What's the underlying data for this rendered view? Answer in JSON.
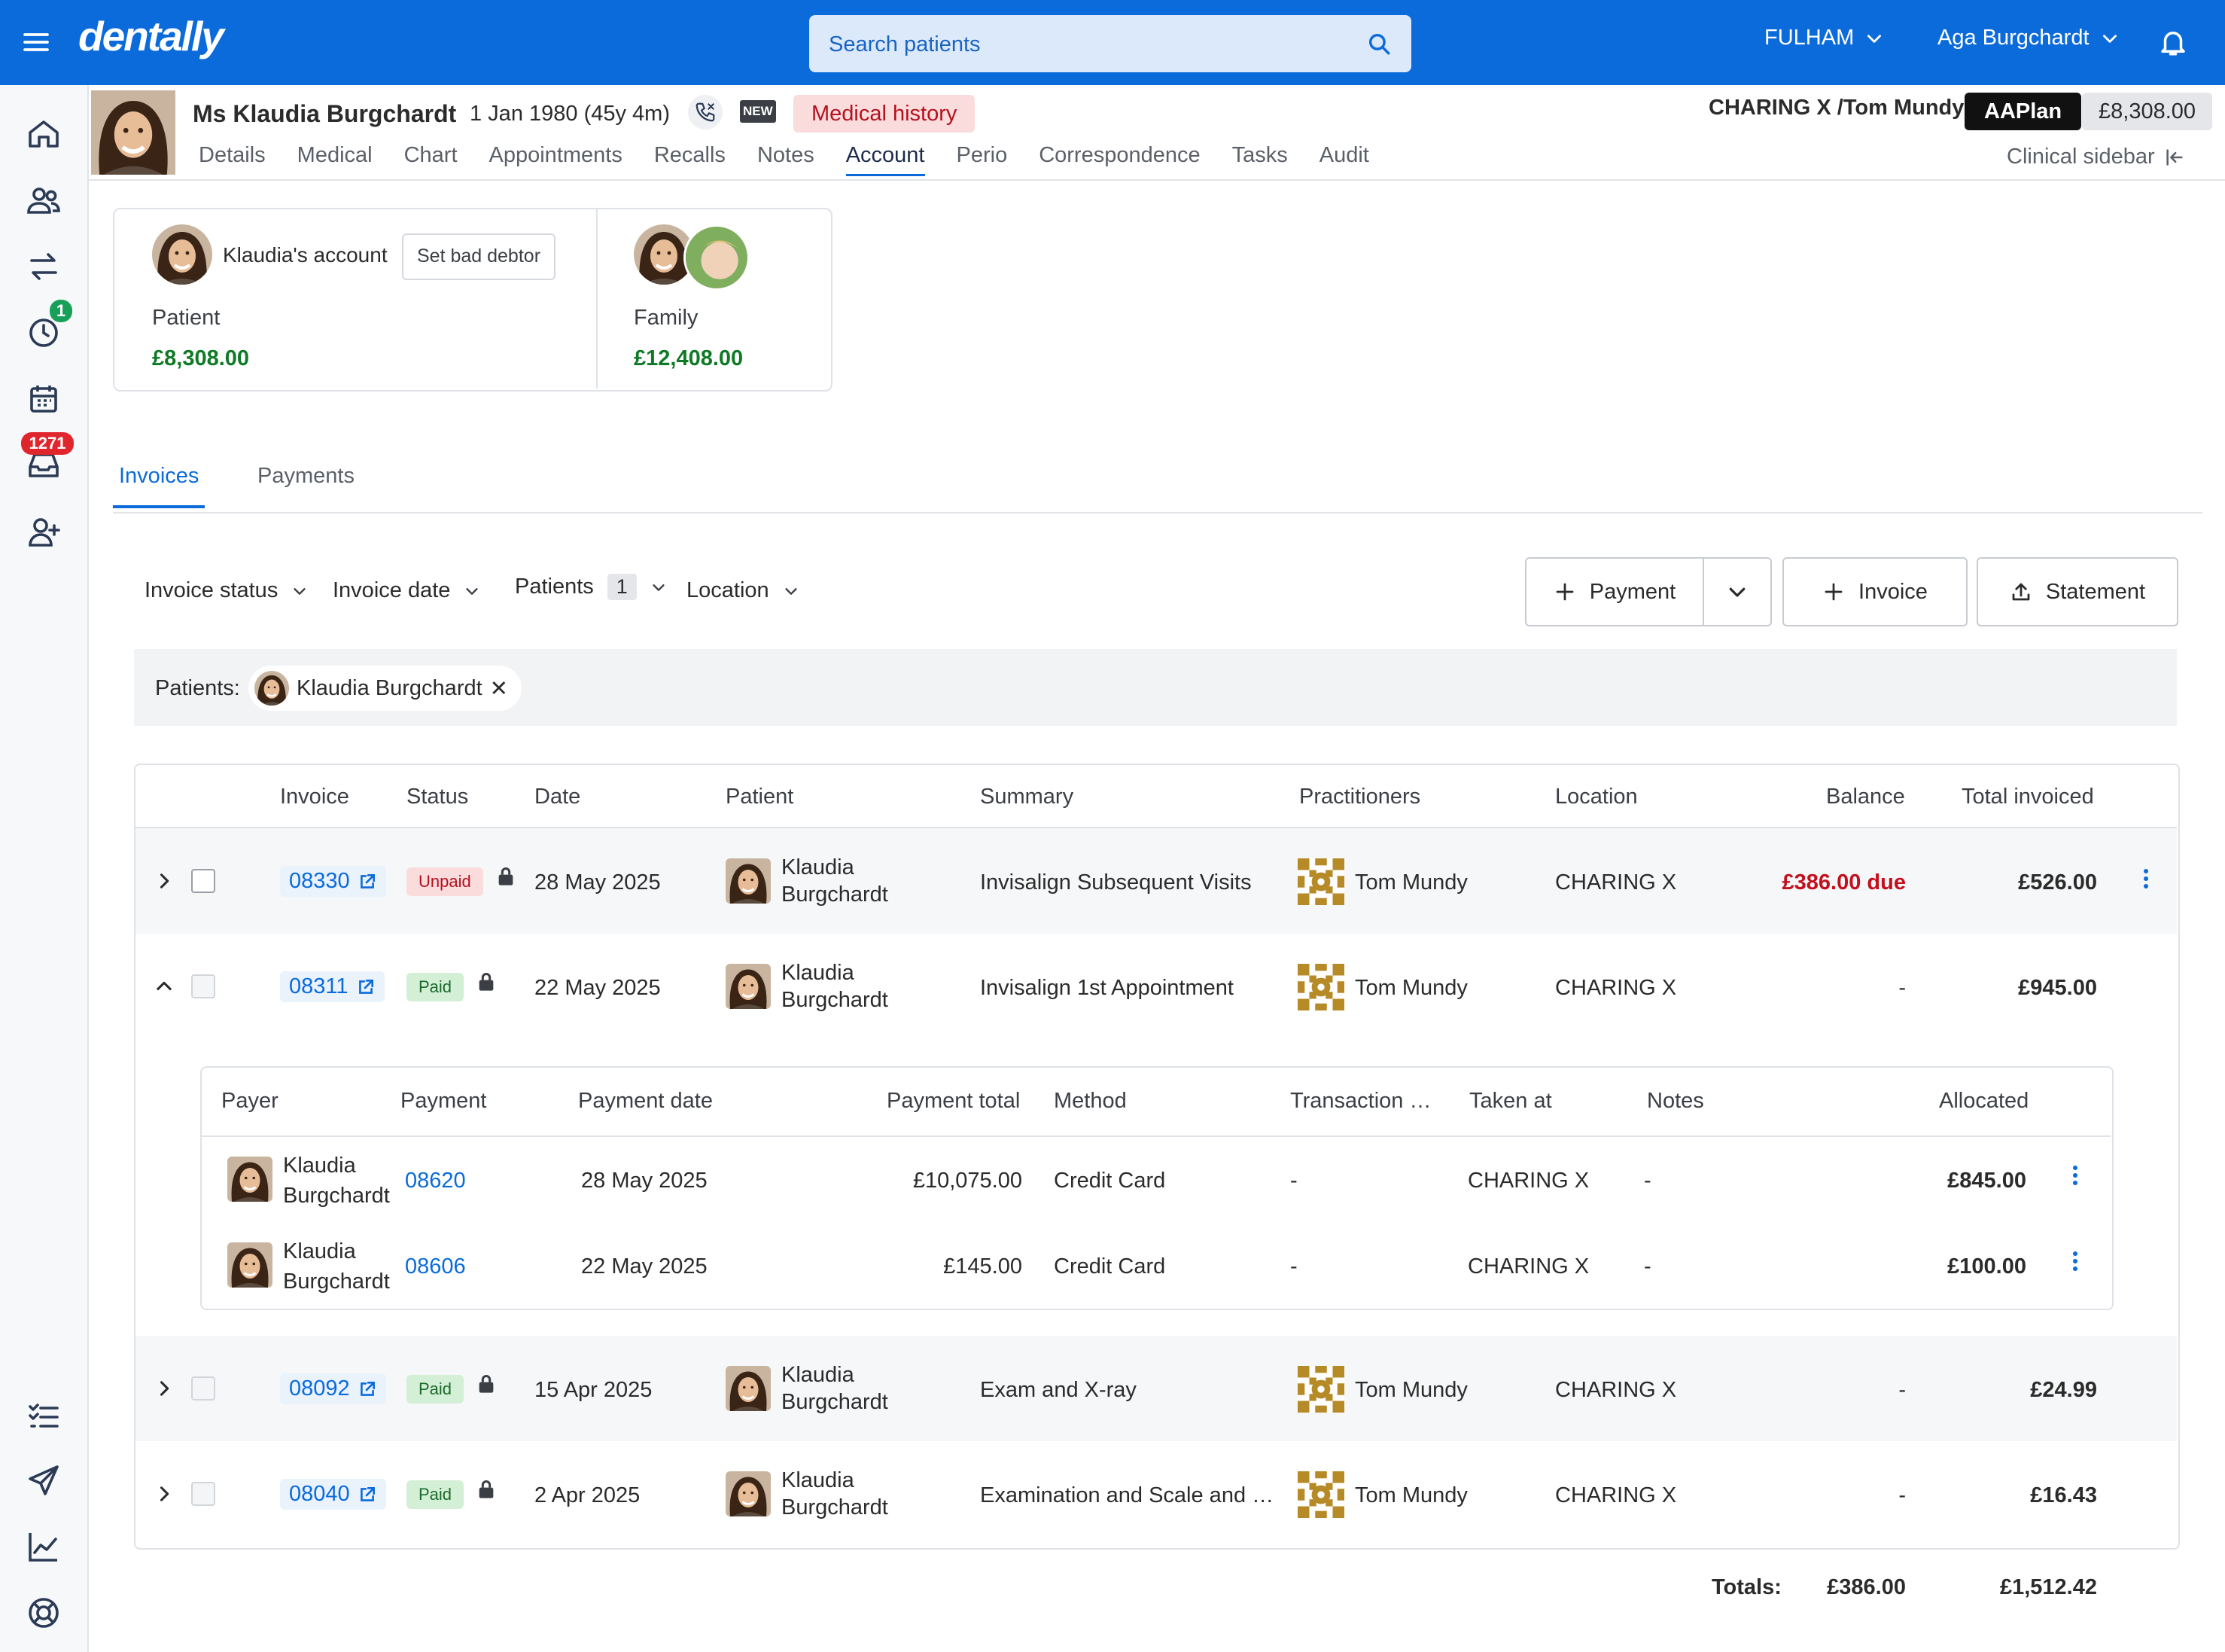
{
  "app": {
    "logo": "dentally"
  },
  "header": {
    "search_placeholder": "Search patients",
    "location": "FULHAM",
    "user": "Aga Burgchardt"
  },
  "sidebar": {
    "items": [
      "home-icon",
      "patients-icon",
      "transfer-icon",
      "clock-icon",
      "calendar-icon",
      "inbox-icon",
      "add-patient-icon",
      "checklist-icon",
      "send-icon",
      "reports-icon",
      "help-icon"
    ],
    "badges": {
      "clock": "1",
      "inbox": "1271"
    }
  },
  "patient": {
    "name": "Ms Klaudia Burgchardt",
    "dob": "1 Jan 1980 (45y 4m)",
    "new_tag": "NEW",
    "medical_history": "Medical history",
    "practice": "CHARING X /Tom Mundy",
    "plan": "AAPlan",
    "balance": "£8,308.00"
  },
  "nav": {
    "tabs": [
      "Details",
      "Medical",
      "Chart",
      "Appointments",
      "Recalls",
      "Notes",
      "Account",
      "Perio",
      "Correspondence",
      "Tasks",
      "Audit"
    ],
    "active": "Account",
    "clinical_sidebar": "Clinical sidebar"
  },
  "account": {
    "title": "Klaudia's account",
    "bad_debtor_btn": "Set bad debtor",
    "patient_label": "Patient",
    "patient_amount": "£8,308.00",
    "family_label": "Family",
    "family_amount": "£12,408.00"
  },
  "subtabs": {
    "invoices": "Invoices",
    "payments": "Payments"
  },
  "filters": {
    "invoice_status": "Invoice status",
    "invoice_date": "Invoice date",
    "patients": "Patients",
    "patients_count": "1",
    "location": "Location"
  },
  "actions": {
    "payment": "Payment",
    "invoice": "Invoice",
    "statement": "Statement"
  },
  "chips": {
    "label": "Patients:",
    "patient": "Klaudia Burgchardt",
    "remove": "✕"
  },
  "table": {
    "headers": [
      "Invoice",
      "Status",
      "Date",
      "Patient",
      "Summary",
      "Practitioners",
      "Location",
      "Balance",
      "Total invoiced"
    ],
    "rows": [
      {
        "invoice": "08330",
        "status": "Unpaid",
        "date": "28 May 2025",
        "patient_first": "Klaudia",
        "patient_last": "Burgchardt",
        "summary": "Invisalign Subsequent Visits",
        "practitioner": "Tom Mundy",
        "location": "CHARING X",
        "balance": "£386.00 due",
        "total": "£526.00"
      },
      {
        "invoice": "08311",
        "status": "Paid",
        "date": "22 May 2025",
        "patient_first": "Klaudia",
        "patient_last": "Burgchardt",
        "summary": "Invisalign 1st Appointment",
        "practitioner": "Tom Mundy",
        "location": "CHARING X",
        "balance": "-",
        "total": "£945.00"
      },
      {
        "invoice": "08092",
        "status": "Paid",
        "date": "15 Apr 2025",
        "patient_first": "Klaudia",
        "patient_last": "Burgchardt",
        "summary": "Exam and X-ray",
        "practitioner": "Tom Mundy",
        "location": "CHARING X",
        "balance": "-",
        "total": "£24.99"
      },
      {
        "invoice": "08040",
        "status": "Paid",
        "date": "2 Apr 2025",
        "patient_first": "Klaudia",
        "patient_last": "Burgchardt",
        "summary": "Examination and Scale and …",
        "practitioner": "Tom Mundy",
        "location": "CHARING X",
        "balance": "-",
        "total": "£16.43"
      }
    ],
    "payments": {
      "headers": [
        "Payer",
        "Payment",
        "Payment date",
        "Payment total",
        "Method",
        "Transaction …",
        "Taken at",
        "Notes",
        "Allocated"
      ],
      "rows": [
        {
          "payer_first": "Klaudia",
          "payer_last": "Burgchardt",
          "payment": "08620",
          "date": "28 May 2025",
          "total": "£10,075.00",
          "method": "Credit Card",
          "transaction": "-",
          "taken_at": "CHARING X",
          "notes": "-",
          "allocated": "£845.00"
        },
        {
          "payer_first": "Klaudia",
          "payer_last": "Burgchardt",
          "payment": "08606",
          "date": "22 May 2025",
          "total": "£145.00",
          "method": "Credit Card",
          "transaction": "-",
          "taken_at": "CHARING X",
          "notes": "-",
          "allocated": "£100.00"
        }
      ]
    },
    "totals_label": "Totals:",
    "totals_balance": "£386.00",
    "totals_invoiced": "£1,512.42"
  },
  "colors": {
    "brand_blue": "#0b6bdb",
    "due_red": "#c3101e",
    "amount_green": "#0f7a26"
  }
}
